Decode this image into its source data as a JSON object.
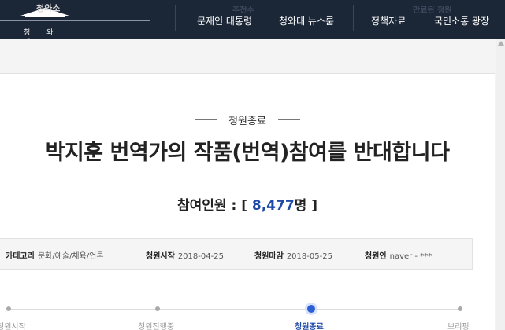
{
  "header": {
    "logo_mark": "청와소",
    "logo_text": "청 와 대",
    "ghost_center": "추천수",
    "ghost_right": "만료된 청원",
    "nav": [
      "문재인 대통령",
      "청와대 뉴스룸",
      "정책자료",
      "국민소통 광장"
    ]
  },
  "petition": {
    "status": "청원종료",
    "title": "박지훈 번역가의 작품(번역)참여를 반대합니다",
    "count_label": "참여인원 :",
    "count_open": "[",
    "count_value": "8,477",
    "count_unit": "명",
    "count_close": "]"
  },
  "info": {
    "category_label": "카테고리",
    "category_value": "문화/예술/체육/언론",
    "start_label": "청원시작",
    "start_value": "2018-04-25",
    "end_label": "청원마감",
    "end_value": "2018-05-25",
    "petitioner_label": "청원인",
    "petitioner_value": "naver - ***"
  },
  "progress": {
    "steps": [
      "청원시작",
      "청원진행중",
      "청원종료",
      "브리핑"
    ],
    "active_index": 2
  },
  "colors": {
    "header_bg": "#1b2636",
    "accent": "#1f4aa8",
    "active_dot": "#2c5fd6"
  }
}
